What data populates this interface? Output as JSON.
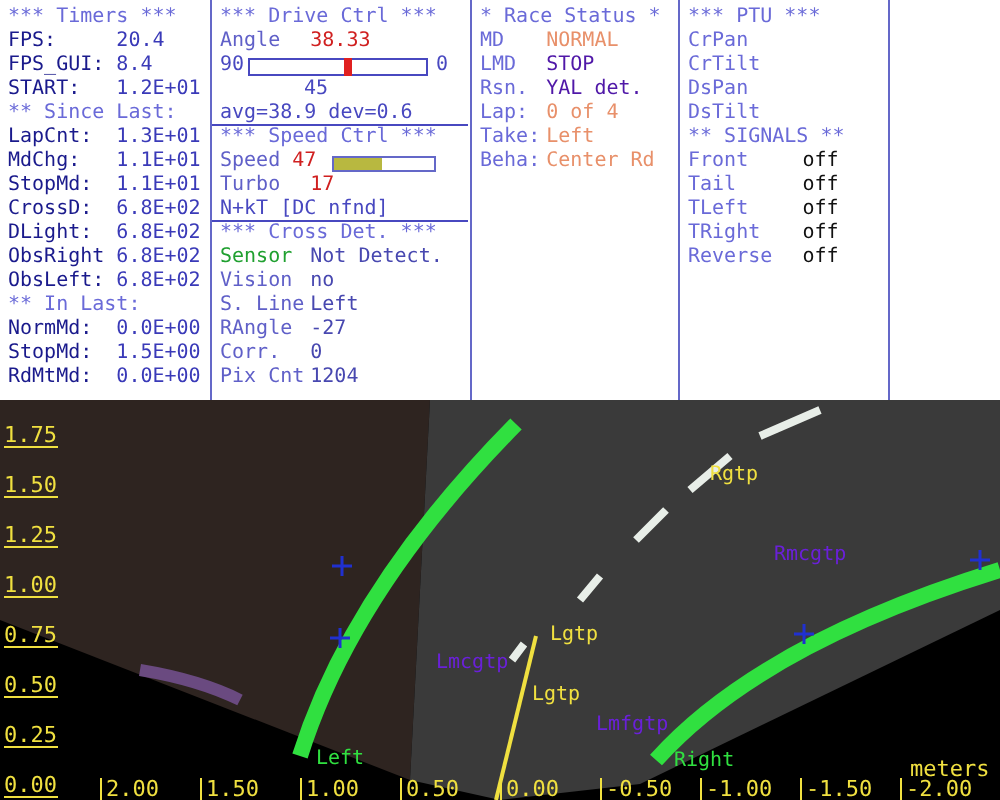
{
  "timers": [
    {
      "kind": "header",
      "text": "*** Timers ***"
    },
    {
      "kind": "field",
      "label": "FPS:",
      "value": "20.4"
    },
    {
      "kind": "field",
      "label": "FPS_GUI:",
      "value": "8.4"
    },
    {
      "kind": "field",
      "label": "START:",
      "value": "1.2E+01"
    },
    {
      "kind": "header",
      "text": "** Since Last:"
    },
    {
      "kind": "field",
      "label": "LapCnt:",
      "value": "1.3E+01"
    },
    {
      "kind": "field",
      "label": "MdChg:",
      "value": "1.1E+01"
    },
    {
      "kind": "field",
      "label": "StopMd:",
      "value": "1.1E+01"
    },
    {
      "kind": "field",
      "label": "CrossD:",
      "value": "6.8E+02"
    },
    {
      "kind": "field",
      "label": "DLight:",
      "value": "6.8E+02"
    },
    {
      "kind": "field",
      "label": "ObsRight",
      "value": "6.8E+02"
    },
    {
      "kind": "field",
      "label": "ObsLeft:",
      "value": "6.8E+02"
    },
    {
      "kind": "header",
      "text": "** In Last:"
    },
    {
      "kind": "field",
      "label": "NormMd:",
      "value": "0.0E+00"
    },
    {
      "kind": "field",
      "label": "StopMd:",
      "value": "1.5E+00"
    },
    {
      "kind": "field",
      "label": "RdMtMd:",
      "value": "0.0E+00"
    }
  ],
  "drive_ctrl": [
    {
      "kind": "header",
      "text": "***  Drive Ctrl  ***"
    },
    {
      "kind": "field",
      "label": "Angle",
      "value": "38.33",
      "color": "#d02020"
    },
    {
      "kind": "gauge",
      "min": "90",
      "max": "0",
      "level": 0.56
    },
    {
      "kind": "center",
      "text": "45"
    },
    {
      "kind": "summary",
      "text": "avg=38.9  dev=0.6"
    },
    {
      "kind": "header",
      "text": "***  Speed Ctrl  ***"
    },
    {
      "kind": "bar",
      "label": "Speed",
      "value": "47",
      "color": "#d02020",
      "level": 0.47
    },
    {
      "kind": "field",
      "label": "Turbo",
      "value": "17",
      "color": "#d02020"
    },
    {
      "kind": "summary",
      "text": "N+kT [DC nfnd]"
    },
    {
      "kind": "header",
      "text": "***  Cross Det.  ***"
    },
    {
      "kind": "label_colored",
      "label": "Sensor",
      "value": "Not Detect.",
      "color": "#20a030"
    },
    {
      "kind": "field",
      "label": "Vision",
      "value": "no"
    },
    {
      "kind": "field",
      "label": "S. Line",
      "value": "Left"
    },
    {
      "kind": "field",
      "label": "RAngle",
      "value": "-27"
    },
    {
      "kind": "field",
      "label": "Corr.",
      "value": "0"
    },
    {
      "kind": "field",
      "label": "Pix Cnt",
      "value": "1204"
    }
  ],
  "race_status": [
    {
      "kind": "header",
      "text": "* Race Status *"
    },
    {
      "kind": "field",
      "label": "MD",
      "value": "NORMAL",
      "color": "#e8906a"
    },
    {
      "kind": "field",
      "label": "LMD",
      "value": "STOP",
      "color": "#5018a8"
    },
    {
      "kind": "field",
      "label": "Rsn.",
      "value": "YAL det.",
      "color": "#5018a8"
    },
    {
      "kind": "field",
      "label": "Lap:",
      "value": "0 of 4",
      "color": "#e8906a"
    },
    {
      "kind": "field",
      "label": "Take:",
      "value": "Left",
      "color": "#e8906a"
    },
    {
      "kind": "field",
      "label": "Beha:",
      "value": "Center Rd",
      "color": "#e8906a"
    }
  ],
  "ptu": [
    {
      "kind": "header",
      "text": "*** PTU ***"
    },
    {
      "kind": "field",
      "label": "CrPan"
    },
    {
      "kind": "field",
      "label": "CrTilt"
    },
    {
      "kind": "field",
      "label": "DsPan"
    },
    {
      "kind": "field",
      "label": "DsTilt"
    },
    {
      "kind": "header",
      "text": "** SIGNALS **"
    },
    {
      "kind": "field",
      "label": "Front",
      "value": "off"
    },
    {
      "kind": "field",
      "label": "Tail",
      "value": "off"
    },
    {
      "kind": "field",
      "label": "TLeft",
      "value": "off"
    },
    {
      "kind": "field",
      "label": "TRight",
      "value": "off"
    },
    {
      "kind": "field",
      "label": "Reverse",
      "value": "off"
    }
  ],
  "road_view": {
    "y_labels": [
      "1.75",
      "1.50",
      "1.25",
      "1.00",
      "0.75",
      "0.50",
      "0.25",
      "0.00"
    ],
    "x_labels": [
      "2.00",
      "1.50",
      "1.00",
      "0.50",
      "0.00",
      "-0.50",
      "-1.00",
      "-1.50",
      "-2.00"
    ],
    "unit": "meters",
    "markers": [
      {
        "label": "Rgtp",
        "color": "#f0e040"
      },
      {
        "label": "Rmcgtp",
        "color": "#6a20d8"
      },
      {
        "label": "Lmcgtp",
        "color": "#6a20d8"
      },
      {
        "label": "Lgtp",
        "color": "#f0e040"
      },
      {
        "label": "Lgtp",
        "color": "#f0e040"
      },
      {
        "label": "Lmfgtp",
        "color": "#6a20d8"
      },
      {
        "label": "Left",
        "color": "#30e040"
      },
      {
        "label": "Right",
        "color": "#30e040"
      }
    ]
  }
}
